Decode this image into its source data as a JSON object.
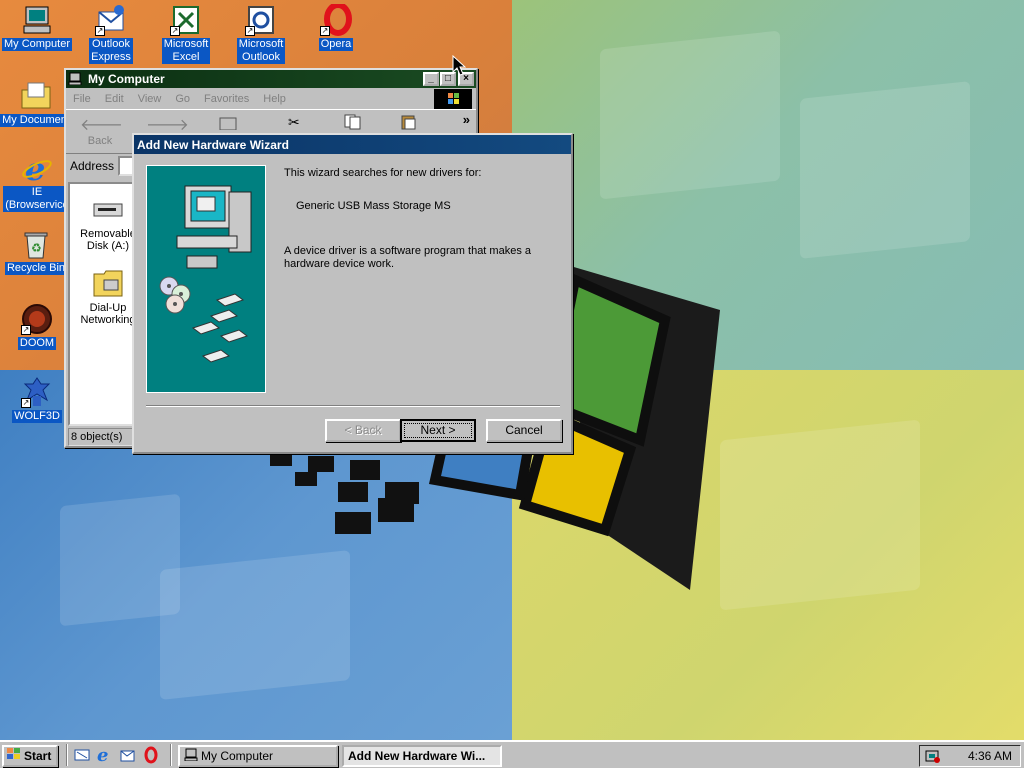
{
  "desktop_icons": [
    {
      "label": "My Computer",
      "icon": "my-computer-icon"
    },
    {
      "label": "Outlook Express",
      "line1": "Outlook",
      "line2": "Express",
      "icon": "outlook-express-icon"
    },
    {
      "label": "Microsoft Excel",
      "line1": "Microsoft",
      "line2": "Excel",
      "icon": "excel-icon"
    },
    {
      "label": "Microsoft Outlook",
      "line1": "Microsoft",
      "line2": "Outlook",
      "icon": "outlook-icon"
    },
    {
      "label": "Opera",
      "icon": "opera-icon"
    },
    {
      "label": "My Documents",
      "short": "My Document",
      "icon": "my-documents-icon"
    },
    {
      "label": "IE (Browservice)",
      "line1": "IE",
      "line2": "(Browservice",
      "icon": "ie-icon"
    },
    {
      "label": "Recycle Bin",
      "short": "Recycle Bin",
      "icon": "recycle-bin-icon"
    },
    {
      "label": "DOOM",
      "icon": "doom-icon"
    },
    {
      "label": "WOLF3D",
      "icon": "wolf3d-icon"
    }
  ],
  "explorer": {
    "title": "My Computer",
    "menu": [
      "File",
      "Edit",
      "View",
      "Go",
      "Favorites",
      "Help"
    ],
    "toolbar": {
      "back": "Back",
      "forward": "",
      "up": ""
    },
    "address_label": "Address",
    "items": [
      {
        "line1": "Removable",
        "line2": "Disk (A:)",
        "icon": "removable-disk-icon"
      },
      {
        "line1": "Dial-Up",
        "line2": "Networking",
        "icon": "dial-up-networking-icon"
      }
    ],
    "status": "8 object(s)"
  },
  "wizard": {
    "title": "Add New Hardware Wizard",
    "intro": "This wizard searches for new drivers for:",
    "device": "Generic USB Mass Storage MS",
    "description_line1": "A device driver is a software program that makes a",
    "description_line2": "hardware device work.",
    "buttons": {
      "back": "< Back",
      "next": "Next >",
      "cancel": "Cancel"
    }
  },
  "taskbar": {
    "start": "Start",
    "tasks": [
      {
        "label": "My Computer",
        "active": false
      },
      {
        "label": "Add New Hardware Wi...",
        "active": true
      }
    ],
    "clock": "4:36 AM"
  },
  "colors": {
    "title_active": "#0a3466",
    "title_inactive": "#0b2f12",
    "wizard_panel": "#008080",
    "face": "#c0c0c0"
  }
}
